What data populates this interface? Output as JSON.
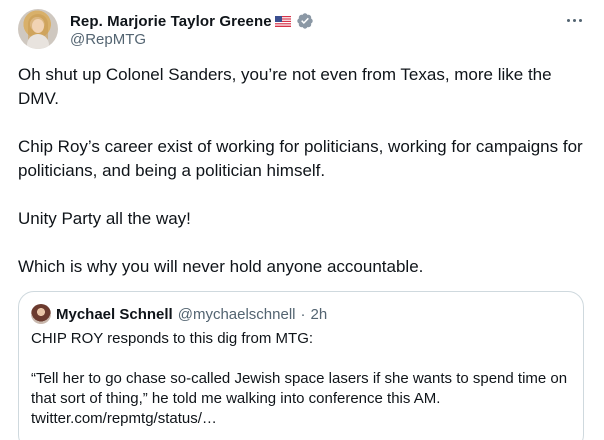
{
  "author": {
    "name": "Rep. Marjorie Taylor Greene",
    "handle": "@RepMTG",
    "flag_icon": "us-flag-icon",
    "verified_icon": "verified-badge-icon",
    "verified_color": "#8b98a5"
  },
  "more_label": "More",
  "tweet": {
    "paragraphs": [
      "Oh shut up Colonel Sanders, you’re not even from Texas, more like the DMV.",
      "Chip Roy’s career exist of working for politicians, working for campaigns for politicians, and being a politician himself.",
      "Unity Party all the way!",
      "Which is why you will never hold anyone accountable."
    ]
  },
  "quote": {
    "name": "Mychael Schnell",
    "handle": "@mychaelschnell",
    "separator": "·",
    "time": "2h",
    "paragraphs": [
      "CHIP ROY responds to this dig from MTG:",
      "“Tell her to go chase so-called Jewish space lasers if she wants to spend time on that sort of thing,” he told me walking into conference this AM. twitter.com/repmtg/status/…"
    ]
  },
  "colors": {
    "text": "#0f1419",
    "secondary": "#536471",
    "border": "#cfd9de"
  }
}
